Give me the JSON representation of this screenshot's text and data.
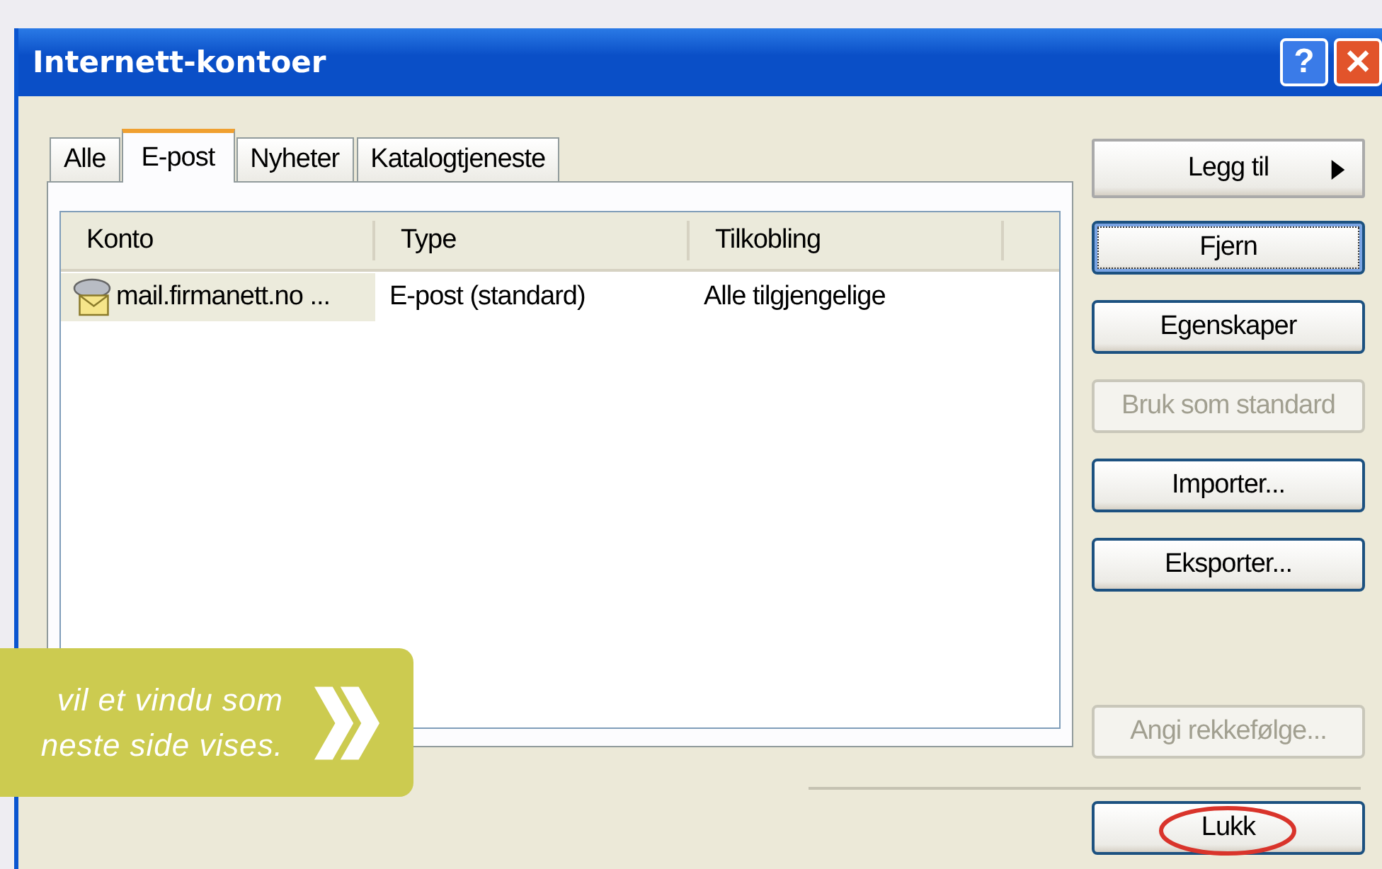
{
  "window": {
    "title": "Internett-kontoer"
  },
  "title_buttons": [
    {
      "kind": "help",
      "label": "?"
    },
    {
      "kind": "close",
      "label": "✕"
    }
  ],
  "tabs": [
    {
      "label": "Alle",
      "selected": false
    },
    {
      "label": "E-post",
      "selected": true
    },
    {
      "label": "Nyheter",
      "selected": false
    },
    {
      "label": "Katalogtjeneste",
      "selected": false
    }
  ],
  "table": {
    "columns": [
      "Konto",
      "Type",
      "Tilkobling"
    ],
    "rows": [
      {
        "cells": [
          "mail.firmanett.no ...",
          "E-post (standard)",
          "Alle tilgjengelige"
        ],
        "selected": true
      }
    ]
  },
  "buttons": [
    {
      "kind": "menu",
      "label": "Legg til",
      "disabled": false,
      "focused": false,
      "highlighted": false
    },
    {
      "kind": "action",
      "label": "Fjern",
      "disabled": false,
      "focused": true,
      "highlighted": false
    },
    {
      "kind": "action",
      "label": "Egenskaper",
      "disabled": false,
      "focused": false,
      "highlighted": false
    },
    {
      "kind": "action",
      "label": "Bruk som standard",
      "disabled": true,
      "focused": false,
      "highlighted": false
    },
    {
      "kind": "action",
      "label": "Importer...",
      "disabled": false,
      "focused": false,
      "highlighted": false
    },
    {
      "kind": "action",
      "label": "Eksporter...",
      "disabled": false,
      "focused": false,
      "highlighted": false
    },
    {
      "kind": "order",
      "label": "Angi rekkefølge...",
      "disabled": true,
      "focused": false,
      "highlighted": false
    },
    {
      "kind": "close",
      "label": "Lukk",
      "disabled": false,
      "focused": false,
      "highlighted": true
    }
  ],
  "callout": {
    "lines": [
      "vil et vindu som",
      "neste side vises."
    ]
  }
}
